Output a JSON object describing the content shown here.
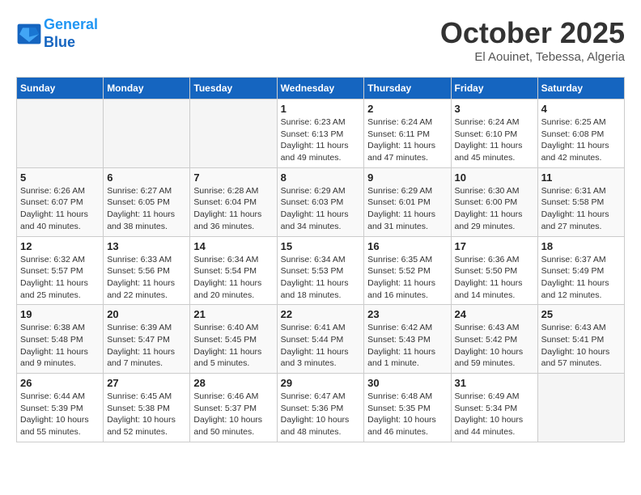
{
  "header": {
    "logo_line1": "General",
    "logo_line2": "Blue",
    "month": "October 2025",
    "location": "El Aouinet, Tebessa, Algeria"
  },
  "days_of_week": [
    "Sunday",
    "Monday",
    "Tuesday",
    "Wednesday",
    "Thursday",
    "Friday",
    "Saturday"
  ],
  "weeks": [
    [
      {
        "num": "",
        "empty": true
      },
      {
        "num": "",
        "empty": true
      },
      {
        "num": "",
        "empty": true
      },
      {
        "num": "1",
        "info": "Sunrise: 6:23 AM\nSunset: 6:13 PM\nDaylight: 11 hours\nand 49 minutes."
      },
      {
        "num": "2",
        "info": "Sunrise: 6:24 AM\nSunset: 6:11 PM\nDaylight: 11 hours\nand 47 minutes."
      },
      {
        "num": "3",
        "info": "Sunrise: 6:24 AM\nSunset: 6:10 PM\nDaylight: 11 hours\nand 45 minutes."
      },
      {
        "num": "4",
        "info": "Sunrise: 6:25 AM\nSunset: 6:08 PM\nDaylight: 11 hours\nand 42 minutes."
      }
    ],
    [
      {
        "num": "5",
        "info": "Sunrise: 6:26 AM\nSunset: 6:07 PM\nDaylight: 11 hours\nand 40 minutes."
      },
      {
        "num": "6",
        "info": "Sunrise: 6:27 AM\nSunset: 6:05 PM\nDaylight: 11 hours\nand 38 minutes."
      },
      {
        "num": "7",
        "info": "Sunrise: 6:28 AM\nSunset: 6:04 PM\nDaylight: 11 hours\nand 36 minutes."
      },
      {
        "num": "8",
        "info": "Sunrise: 6:29 AM\nSunset: 6:03 PM\nDaylight: 11 hours\nand 34 minutes."
      },
      {
        "num": "9",
        "info": "Sunrise: 6:29 AM\nSunset: 6:01 PM\nDaylight: 11 hours\nand 31 minutes."
      },
      {
        "num": "10",
        "info": "Sunrise: 6:30 AM\nSunset: 6:00 PM\nDaylight: 11 hours\nand 29 minutes."
      },
      {
        "num": "11",
        "info": "Sunrise: 6:31 AM\nSunset: 5:58 PM\nDaylight: 11 hours\nand 27 minutes."
      }
    ],
    [
      {
        "num": "12",
        "info": "Sunrise: 6:32 AM\nSunset: 5:57 PM\nDaylight: 11 hours\nand 25 minutes."
      },
      {
        "num": "13",
        "info": "Sunrise: 6:33 AM\nSunset: 5:56 PM\nDaylight: 11 hours\nand 22 minutes."
      },
      {
        "num": "14",
        "info": "Sunrise: 6:34 AM\nSunset: 5:54 PM\nDaylight: 11 hours\nand 20 minutes."
      },
      {
        "num": "15",
        "info": "Sunrise: 6:34 AM\nSunset: 5:53 PM\nDaylight: 11 hours\nand 18 minutes."
      },
      {
        "num": "16",
        "info": "Sunrise: 6:35 AM\nSunset: 5:52 PM\nDaylight: 11 hours\nand 16 minutes."
      },
      {
        "num": "17",
        "info": "Sunrise: 6:36 AM\nSunset: 5:50 PM\nDaylight: 11 hours\nand 14 minutes."
      },
      {
        "num": "18",
        "info": "Sunrise: 6:37 AM\nSunset: 5:49 PM\nDaylight: 11 hours\nand 12 minutes."
      }
    ],
    [
      {
        "num": "19",
        "info": "Sunrise: 6:38 AM\nSunset: 5:48 PM\nDaylight: 11 hours\nand 9 minutes."
      },
      {
        "num": "20",
        "info": "Sunrise: 6:39 AM\nSunset: 5:47 PM\nDaylight: 11 hours\nand 7 minutes."
      },
      {
        "num": "21",
        "info": "Sunrise: 6:40 AM\nSunset: 5:45 PM\nDaylight: 11 hours\nand 5 minutes."
      },
      {
        "num": "22",
        "info": "Sunrise: 6:41 AM\nSunset: 5:44 PM\nDaylight: 11 hours\nand 3 minutes."
      },
      {
        "num": "23",
        "info": "Sunrise: 6:42 AM\nSunset: 5:43 PM\nDaylight: 11 hours\nand 1 minute."
      },
      {
        "num": "24",
        "info": "Sunrise: 6:43 AM\nSunset: 5:42 PM\nDaylight: 10 hours\nand 59 minutes."
      },
      {
        "num": "25",
        "info": "Sunrise: 6:43 AM\nSunset: 5:41 PM\nDaylight: 10 hours\nand 57 minutes."
      }
    ],
    [
      {
        "num": "26",
        "info": "Sunrise: 6:44 AM\nSunset: 5:39 PM\nDaylight: 10 hours\nand 55 minutes."
      },
      {
        "num": "27",
        "info": "Sunrise: 6:45 AM\nSunset: 5:38 PM\nDaylight: 10 hours\nand 52 minutes."
      },
      {
        "num": "28",
        "info": "Sunrise: 6:46 AM\nSunset: 5:37 PM\nDaylight: 10 hours\nand 50 minutes."
      },
      {
        "num": "29",
        "info": "Sunrise: 6:47 AM\nSunset: 5:36 PM\nDaylight: 10 hours\nand 48 minutes."
      },
      {
        "num": "30",
        "info": "Sunrise: 6:48 AM\nSunset: 5:35 PM\nDaylight: 10 hours\nand 46 minutes."
      },
      {
        "num": "31",
        "info": "Sunrise: 6:49 AM\nSunset: 5:34 PM\nDaylight: 10 hours\nand 44 minutes."
      },
      {
        "num": "",
        "empty": true
      }
    ]
  ]
}
